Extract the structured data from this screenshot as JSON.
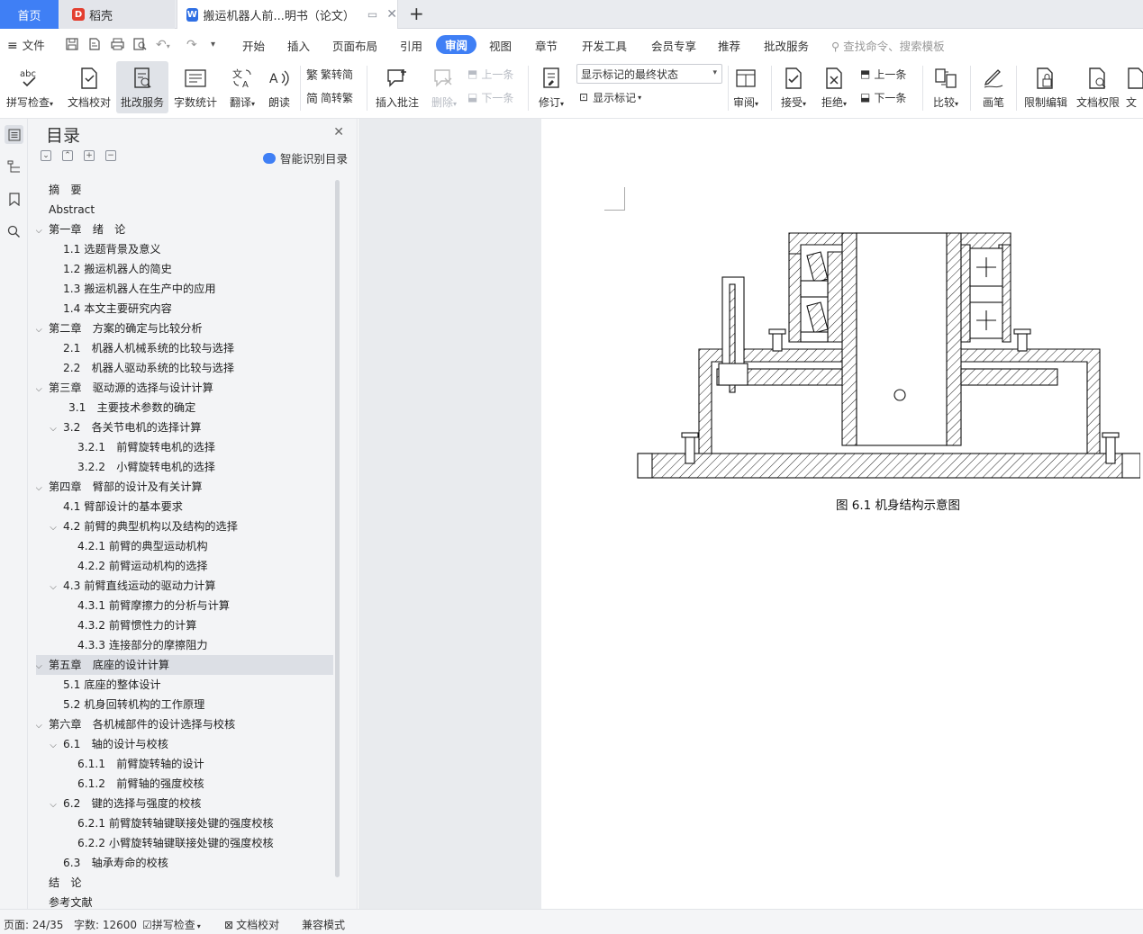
{
  "tabs": {
    "home": "首页",
    "daoke": "稻壳",
    "doc": "搬运机器人前...明书（论文）"
  },
  "menu": {
    "file": "文件",
    "items": [
      "开始",
      "插入",
      "页面布局",
      "引用",
      "审阅",
      "视图",
      "章节",
      "开发工具",
      "会员专享",
      "推荐",
      "批改服务"
    ],
    "active": "审阅",
    "search_placeholder": "查找命令、搜索模板"
  },
  "ribbon": {
    "spell_check": "拼写检查",
    "doc_proof": "文档校对",
    "review_service": "批改服务",
    "word_count": "字数统计",
    "translate": "翻译",
    "read_aloud": "朗读",
    "trad_simp": "繁转简",
    "simp_trad": "简转繁",
    "insert_comment": "插入批注",
    "delete": "删除",
    "prev": "上一条",
    "next": "下一条",
    "revise": "修订",
    "markup_state": "显示标记的最终状态",
    "show_markup": "显示标记",
    "review": "审阅",
    "accept": "接受",
    "reject": "拒绝",
    "prev2": "上一条",
    "next2": "下一条",
    "compare": "比较",
    "ink": "画笔",
    "restrict_edit": "限制编辑",
    "doc_rights": "文档权限",
    "doc_more": "文"
  },
  "nav": {
    "title": "目录",
    "smart_toc": "智能识别目录",
    "items": [
      {
        "label": "摘　要",
        "level": 0,
        "expand": "none"
      },
      {
        "label": "Abstract",
        "level": 0,
        "expand": "none"
      },
      {
        "label": "第一章　绪　论",
        "level": 0,
        "expand": "open"
      },
      {
        "label": "1.1 选题背景及意义",
        "level": 1,
        "expand": "none"
      },
      {
        "label": "1.2  搬运机器人的简史",
        "level": 1,
        "expand": "none"
      },
      {
        "label": "1.3 搬运机器人在生产中的应用",
        "level": 1,
        "expand": "none"
      },
      {
        "label": "1.4 本文主要研究内容",
        "level": 1,
        "expand": "none"
      },
      {
        "label": "第二章　方案的确定与比较分析",
        "level": 0,
        "expand": "open"
      },
      {
        "label": "2.1　机器人机械系统的比较与选择",
        "level": 1,
        "expand": "none"
      },
      {
        "label": "2.2　机器人驱动系统的比较与选择",
        "level": 1,
        "expand": "none"
      },
      {
        "label": "第三章　驱动源的选择与设计计算",
        "level": 0,
        "expand": "open"
      },
      {
        "label": "3.1　主要技术参数的确定",
        "level": 1.4,
        "expand": "none"
      },
      {
        "label": "3.2　各关节电机的选择计算",
        "level": 1,
        "expand": "open"
      },
      {
        "label": "3.2.1　前臂旋转电机的选择",
        "level": 2,
        "expand": "none"
      },
      {
        "label": "3.2.2　小臂旋转电机的选择",
        "level": 2,
        "expand": "none"
      },
      {
        "label": "第四章　臂部的设计及有关计算",
        "level": 0,
        "expand": "open"
      },
      {
        "label": "4.1  臂部设计的基本要求",
        "level": 1,
        "expand": "none"
      },
      {
        "label": "4.2  前臂的典型机构以及结构的选择",
        "level": 1,
        "expand": "open"
      },
      {
        "label": "4.2.1  前臂的典型运动机构",
        "level": 2,
        "expand": "none"
      },
      {
        "label": "4.2.2  前臂运动机构的选择",
        "level": 2,
        "expand": "none"
      },
      {
        "label": "4.3  前臂直线运动的驱动力计算",
        "level": 1,
        "expand": "open"
      },
      {
        "label": "4.3.1  前臂摩擦力的分析与计算",
        "level": 2,
        "expand": "none"
      },
      {
        "label": "4.3.2  前臂惯性力的计算",
        "level": 2,
        "expand": "none"
      },
      {
        "label": "4.3.3 连接部分的摩擦阻力",
        "level": 2,
        "expand": "none"
      },
      {
        "label": "第五章　底座的设计计算",
        "level": 0,
        "expand": "open",
        "selected": true
      },
      {
        "label": "5.1  底座的整体设计",
        "level": 1,
        "expand": "none"
      },
      {
        "label": "5.2  机身回转机构的工作原理",
        "level": 1,
        "expand": "none"
      },
      {
        "label": "第六章　各机械部件的设计选择与校核",
        "level": 0,
        "expand": "open"
      },
      {
        "label": "6.1　轴的设计与校核",
        "level": 1,
        "expand": "open"
      },
      {
        "label": "6.1.1　前臂旋转轴的设计",
        "level": 2,
        "expand": "none"
      },
      {
        "label": "6.1.2　前臂轴的强度校核",
        "level": 2,
        "expand": "none"
      },
      {
        "label": "6.2　键的选择与强度的校核",
        "level": 1,
        "expand": "open"
      },
      {
        "label": "6.2.1 前臂旋转轴键联接处键的强度校核",
        "level": 2,
        "expand": "none"
      },
      {
        "label": "6.2.2 小臂旋转轴键联接处键的强度校核",
        "level": 2,
        "expand": "none"
      },
      {
        "label": "6.3　轴承寿命的校核",
        "level": 1,
        "expand": "none"
      },
      {
        "label": "结　论",
        "level": 0,
        "expand": "none"
      },
      {
        "label": "参考文献",
        "level": 0,
        "expand": "none"
      }
    ]
  },
  "document": {
    "figure_caption": "图 6.1 机身结构示意图"
  },
  "status": {
    "page": "页面: 24/35",
    "words": "字数: 12600",
    "spell": "拼写检查",
    "proof": "文档校对",
    "compat": "兼容模式"
  },
  "colors": {
    "accent": "#3f7ff5",
    "daoke_red": "#e33e2f"
  }
}
